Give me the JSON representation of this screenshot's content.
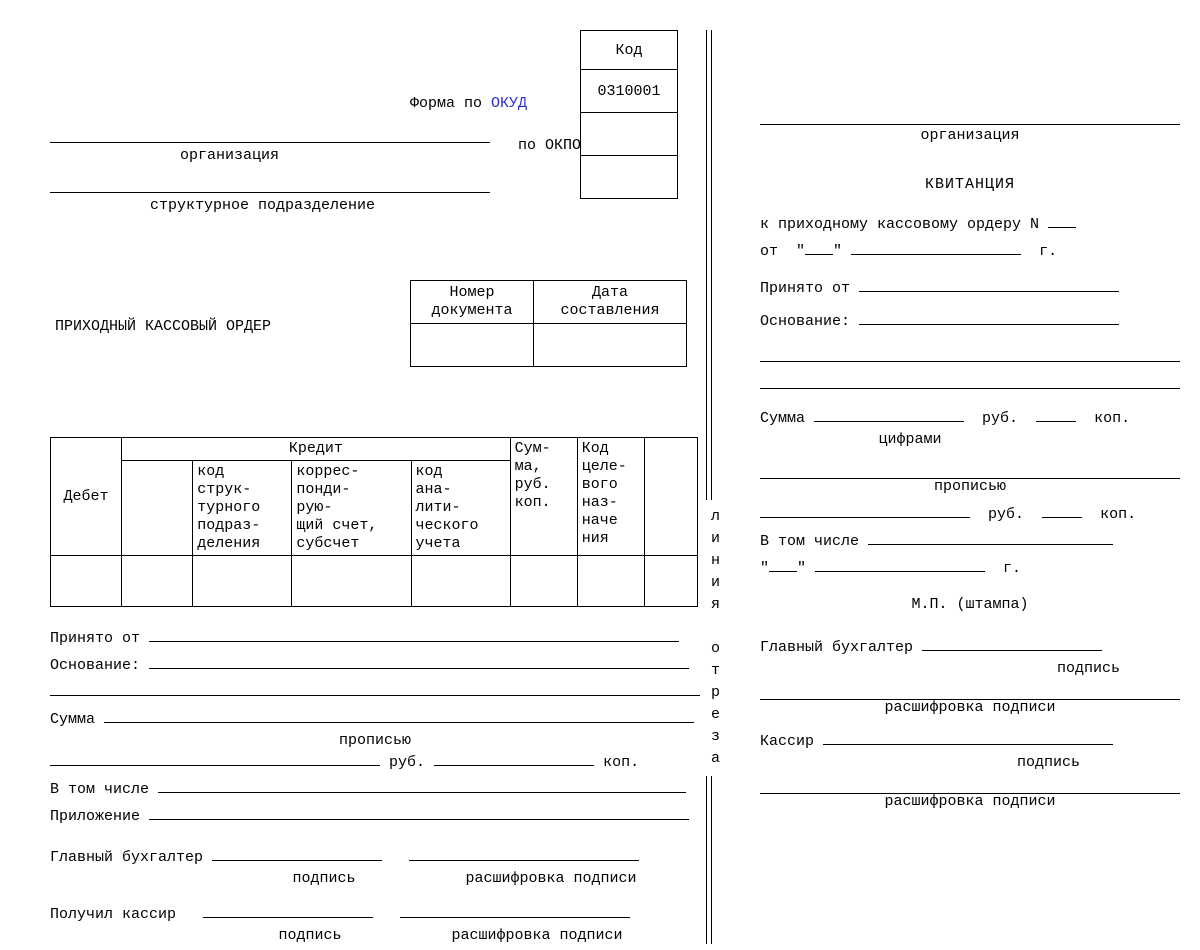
{
  "left": {
    "code_header": "Код",
    "form_by": "Форма по",
    "okud_link": "ОКУД",
    "okud_code": "0310001",
    "by_okpo": "по ОКПО",
    "org_caption": "организация",
    "subdiv_caption": "структурное подразделение",
    "numdate": {
      "num_h1": "Номер",
      "num_h2": "документа",
      "date_h1": "Дата",
      "date_h2": "составления"
    },
    "title": "ПРИХОДНЫЙ КАССОВЫЙ ОРДЕР",
    "tbl": {
      "debit": "Дебет",
      "credit": "Кредит",
      "sum": "Сум-\nма,\nруб.\nкоп.",
      "code_purpose": "Код\nцеле-\nвого\nназ-\nначе\nния",
      "c1": "код\nструк-\nтурного\nподраз-\nделения",
      "c2": "коррес-\nпонди-\nрую-\nщий счет,\nсубсчет",
      "c3": "код\nана-\nлити-\nческого\nучета"
    },
    "free": {
      "received_from": "Принято от",
      "basis": "Основание:",
      "sum": "Сумма",
      "in_words": "прописью",
      "rub": "руб.",
      "kop": "коп.",
      "including": "В том числе",
      "attachment": "Приложение",
      "chief_acc": "Главный бухгалтер",
      "signature": "подпись",
      "sig_decode": "расшифровка подписи",
      "cashier_got": "Получил кассир"
    }
  },
  "cut": {
    "label": "линия отреза"
  },
  "right": {
    "org_caption": "организация",
    "receipt": "КВИТАНЦИЯ",
    "to_order": "к приходному кассовому ордеру N",
    "from": "от",
    "year_g": "г.",
    "received_from": "Принято от",
    "basis": "Основание:",
    "sum": "Сумма",
    "digits": "цифрами",
    "rub": "руб.",
    "kop": "коп.",
    "in_words": "прописью",
    "including": "В том числе",
    "mp": "М.П. (штампа)",
    "chief_acc": "Главный бухгалтер",
    "signature": "подпись",
    "sig_decode": "расшифровка подписи",
    "cashier": "Кассир"
  }
}
